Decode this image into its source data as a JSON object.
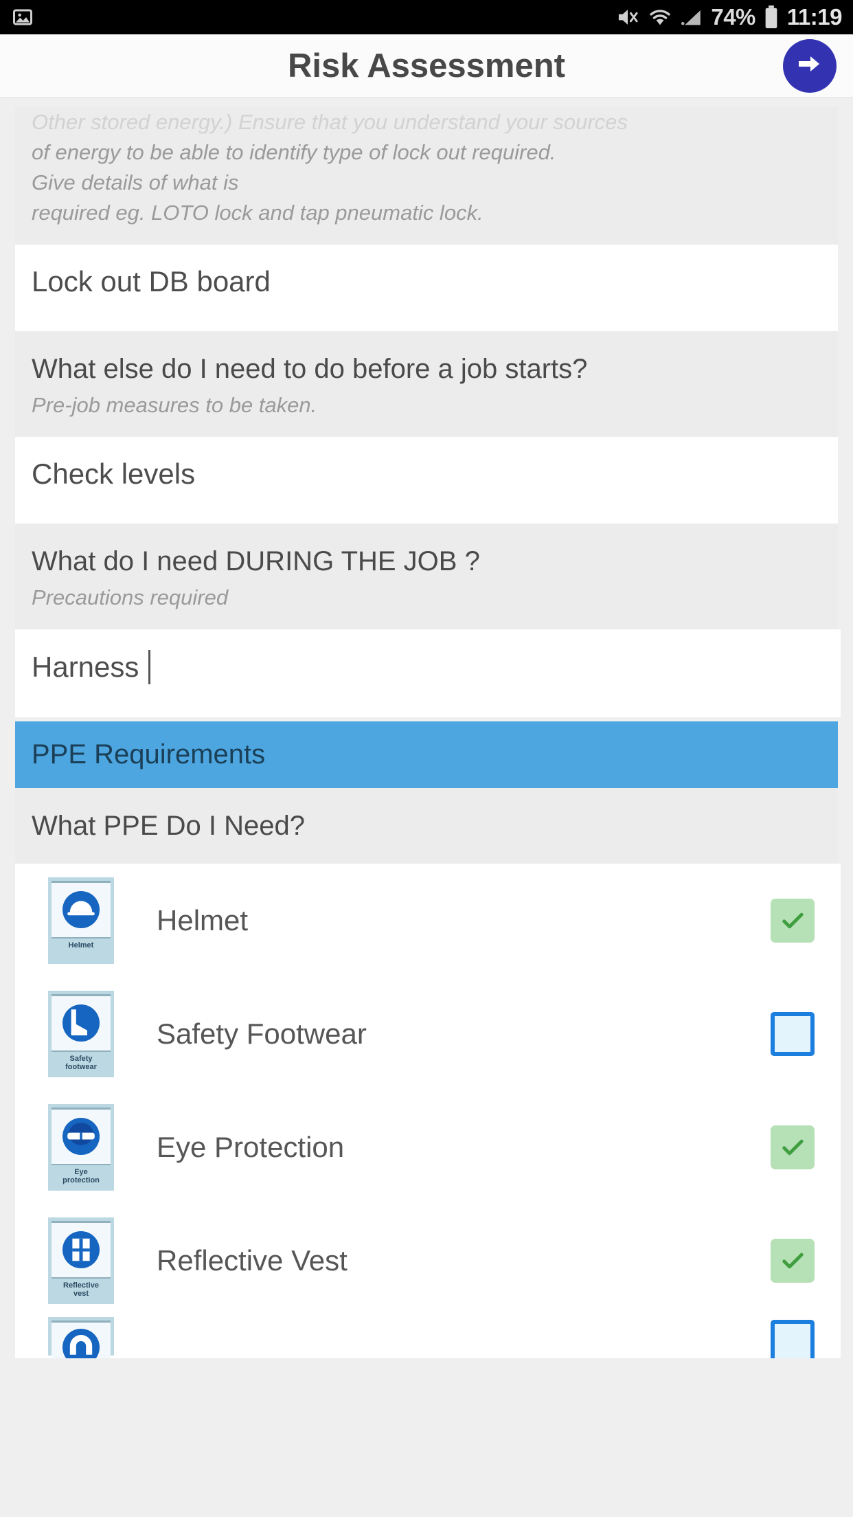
{
  "status_bar": {
    "notification_icon": "image-notification-icon",
    "mute_icon": "mute-icon",
    "wifi_icon": "wifi-icon",
    "signal_icon": "signal-icon",
    "battery_percent": "74%",
    "battery_icon": "battery-icon",
    "clock": "11:19"
  },
  "app_bar": {
    "title": "Risk Assessment",
    "next_icon": "arrow-right-icon",
    "next_color": "#3333b2"
  },
  "colors": {
    "section_header_bg": "#4da6e0",
    "checked_bg": "#b6e0b6",
    "check_mark": "#3f9e3f",
    "unchecked_border": "#1c7fe0",
    "page_bg": "#efefef",
    "question_bg": "#ececec"
  },
  "form": {
    "blocks": [
      {
        "hint_clipped": "Other stored energy.) Ensure that you understand your sources",
        "hint_lines": [
          "of energy to be able to identify type of lock out required.",
          "Give details of what is",
          "required eg. LOTO lock and tap pneumatic lock."
        ],
        "answer": "Lock out DB board"
      },
      {
        "title": "What else do I need to do before a job starts?",
        "hint": "Pre-job measures to be taken.",
        "answer": "Check levels"
      },
      {
        "title": "What do I need DURING THE JOB ?",
        "hint": "Precautions required",
        "answer": "Harness"
      }
    ]
  },
  "ppe_section": {
    "header": "PPE Requirements",
    "question": "What  PPE Do  I Need?",
    "items": [
      {
        "label": "Helmet",
        "sign_caption": "Helmet",
        "sign_icon": "helmet-sign-icon",
        "checked": true
      },
      {
        "label": "Safety Footwear",
        "sign_caption": "Safety\nfootwear",
        "sign_icon": "safety-boot-sign-icon",
        "checked": false
      },
      {
        "label": "Eye Protection",
        "sign_caption": "Eye\nprotection",
        "sign_icon": "eye-protection-sign-icon",
        "checked": true
      },
      {
        "label": "Reflective Vest",
        "sign_caption": "Reflective\nvest",
        "sign_icon": "reflective-vest-sign-icon",
        "checked": true
      },
      {
        "label": "",
        "sign_caption": "",
        "sign_icon": "ear-protection-sign-icon",
        "checked": false
      }
    ]
  }
}
